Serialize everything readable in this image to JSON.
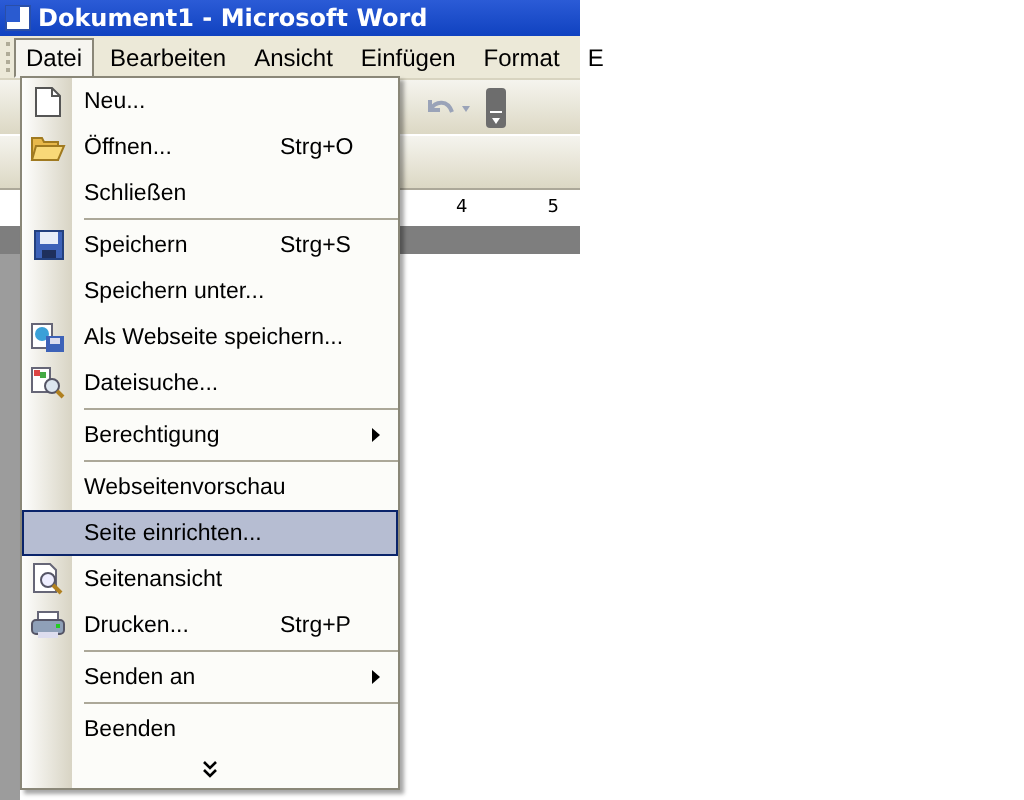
{
  "window": {
    "title": "Dokument1 - Microsoft Word"
  },
  "menubar": [
    {
      "label": "Datei",
      "selected": true
    },
    {
      "label": "Bearbeiten",
      "selected": false
    },
    {
      "label": "Ansicht",
      "selected": false
    },
    {
      "label": "Einfügen",
      "selected": false
    },
    {
      "label": "Format",
      "selected": false
    },
    {
      "label": "E",
      "selected": false
    }
  ],
  "ruler": [
    "4",
    "5"
  ],
  "file_menu": [
    {
      "kind": "item",
      "label": "Neu...",
      "selected": false
    },
    {
      "kind": "item",
      "label": "Öffnen...",
      "shortcut": "Strg+O",
      "selected": false
    },
    {
      "kind": "item",
      "label": "Schließen",
      "selected": false
    },
    {
      "kind": "separator"
    },
    {
      "kind": "item",
      "label": "Speichern",
      "shortcut": "Strg+S",
      "selected": false
    },
    {
      "kind": "item",
      "label": "Speichern unter...",
      "selected": false
    },
    {
      "kind": "item",
      "label": "Als Webseite speichern...",
      "selected": false
    },
    {
      "kind": "item",
      "label": "Dateisuche...",
      "selected": false
    },
    {
      "kind": "separator"
    },
    {
      "kind": "submenu",
      "label": "Berechtigung",
      "selected": false
    },
    {
      "kind": "separator"
    },
    {
      "kind": "item",
      "label": "Webseitenvorschau",
      "selected": false
    },
    {
      "kind": "item",
      "label": "Seite einrichten...",
      "selected": true
    },
    {
      "kind": "item",
      "label": "Seitenansicht",
      "selected": false
    },
    {
      "kind": "item",
      "label": "Drucken...",
      "shortcut": "Strg+P",
      "selected": false
    },
    {
      "kind": "separator"
    },
    {
      "kind": "submenu",
      "label": "Senden an",
      "selected": false
    },
    {
      "kind": "separator"
    },
    {
      "kind": "item",
      "label": "Beenden",
      "selected": false
    },
    {
      "kind": "expand"
    }
  ]
}
